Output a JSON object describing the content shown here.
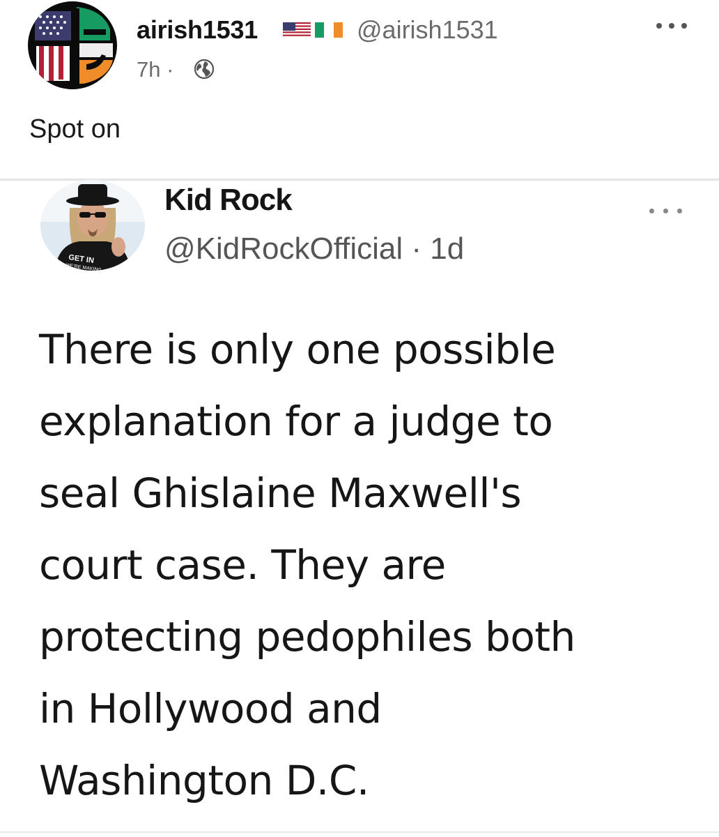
{
  "post": {
    "author_name": "airish1531",
    "author_flags": [
      "us-flag-icon",
      "ireland-flag-icon"
    ],
    "author_handle": "@airish1531",
    "age": "7h",
    "separator": "·",
    "visibility_icon": "globe-icon",
    "more_icon": "more-horizontal-icon",
    "body": "Spot on"
  },
  "quoted_tweet": {
    "author_name": "Kid Rock",
    "handle_and_age": "@KidRockOfficial · 1d",
    "more_icon": "more-horizontal-icon",
    "avatar_shirt_text": "GET IN",
    "avatar_shirt_subtext": "WE'RE MAKING",
    "lines": [
      "There is only one possible",
      "explanation for a judge to",
      "seal Ghislaine Maxwell's",
      "court case. They are",
      "protecting pedophiles both",
      "in Hollywood and",
      "Washington D.C."
    ]
  },
  "colors": {
    "text_primary": "#141414",
    "text_secondary": "#6b6b6b",
    "divider": "#e4e4e4",
    "flag_green": "#169b62",
    "flag_orange": "#f08c2a",
    "flag_red": "#b22234",
    "flag_blue": "#3c3b6e"
  }
}
